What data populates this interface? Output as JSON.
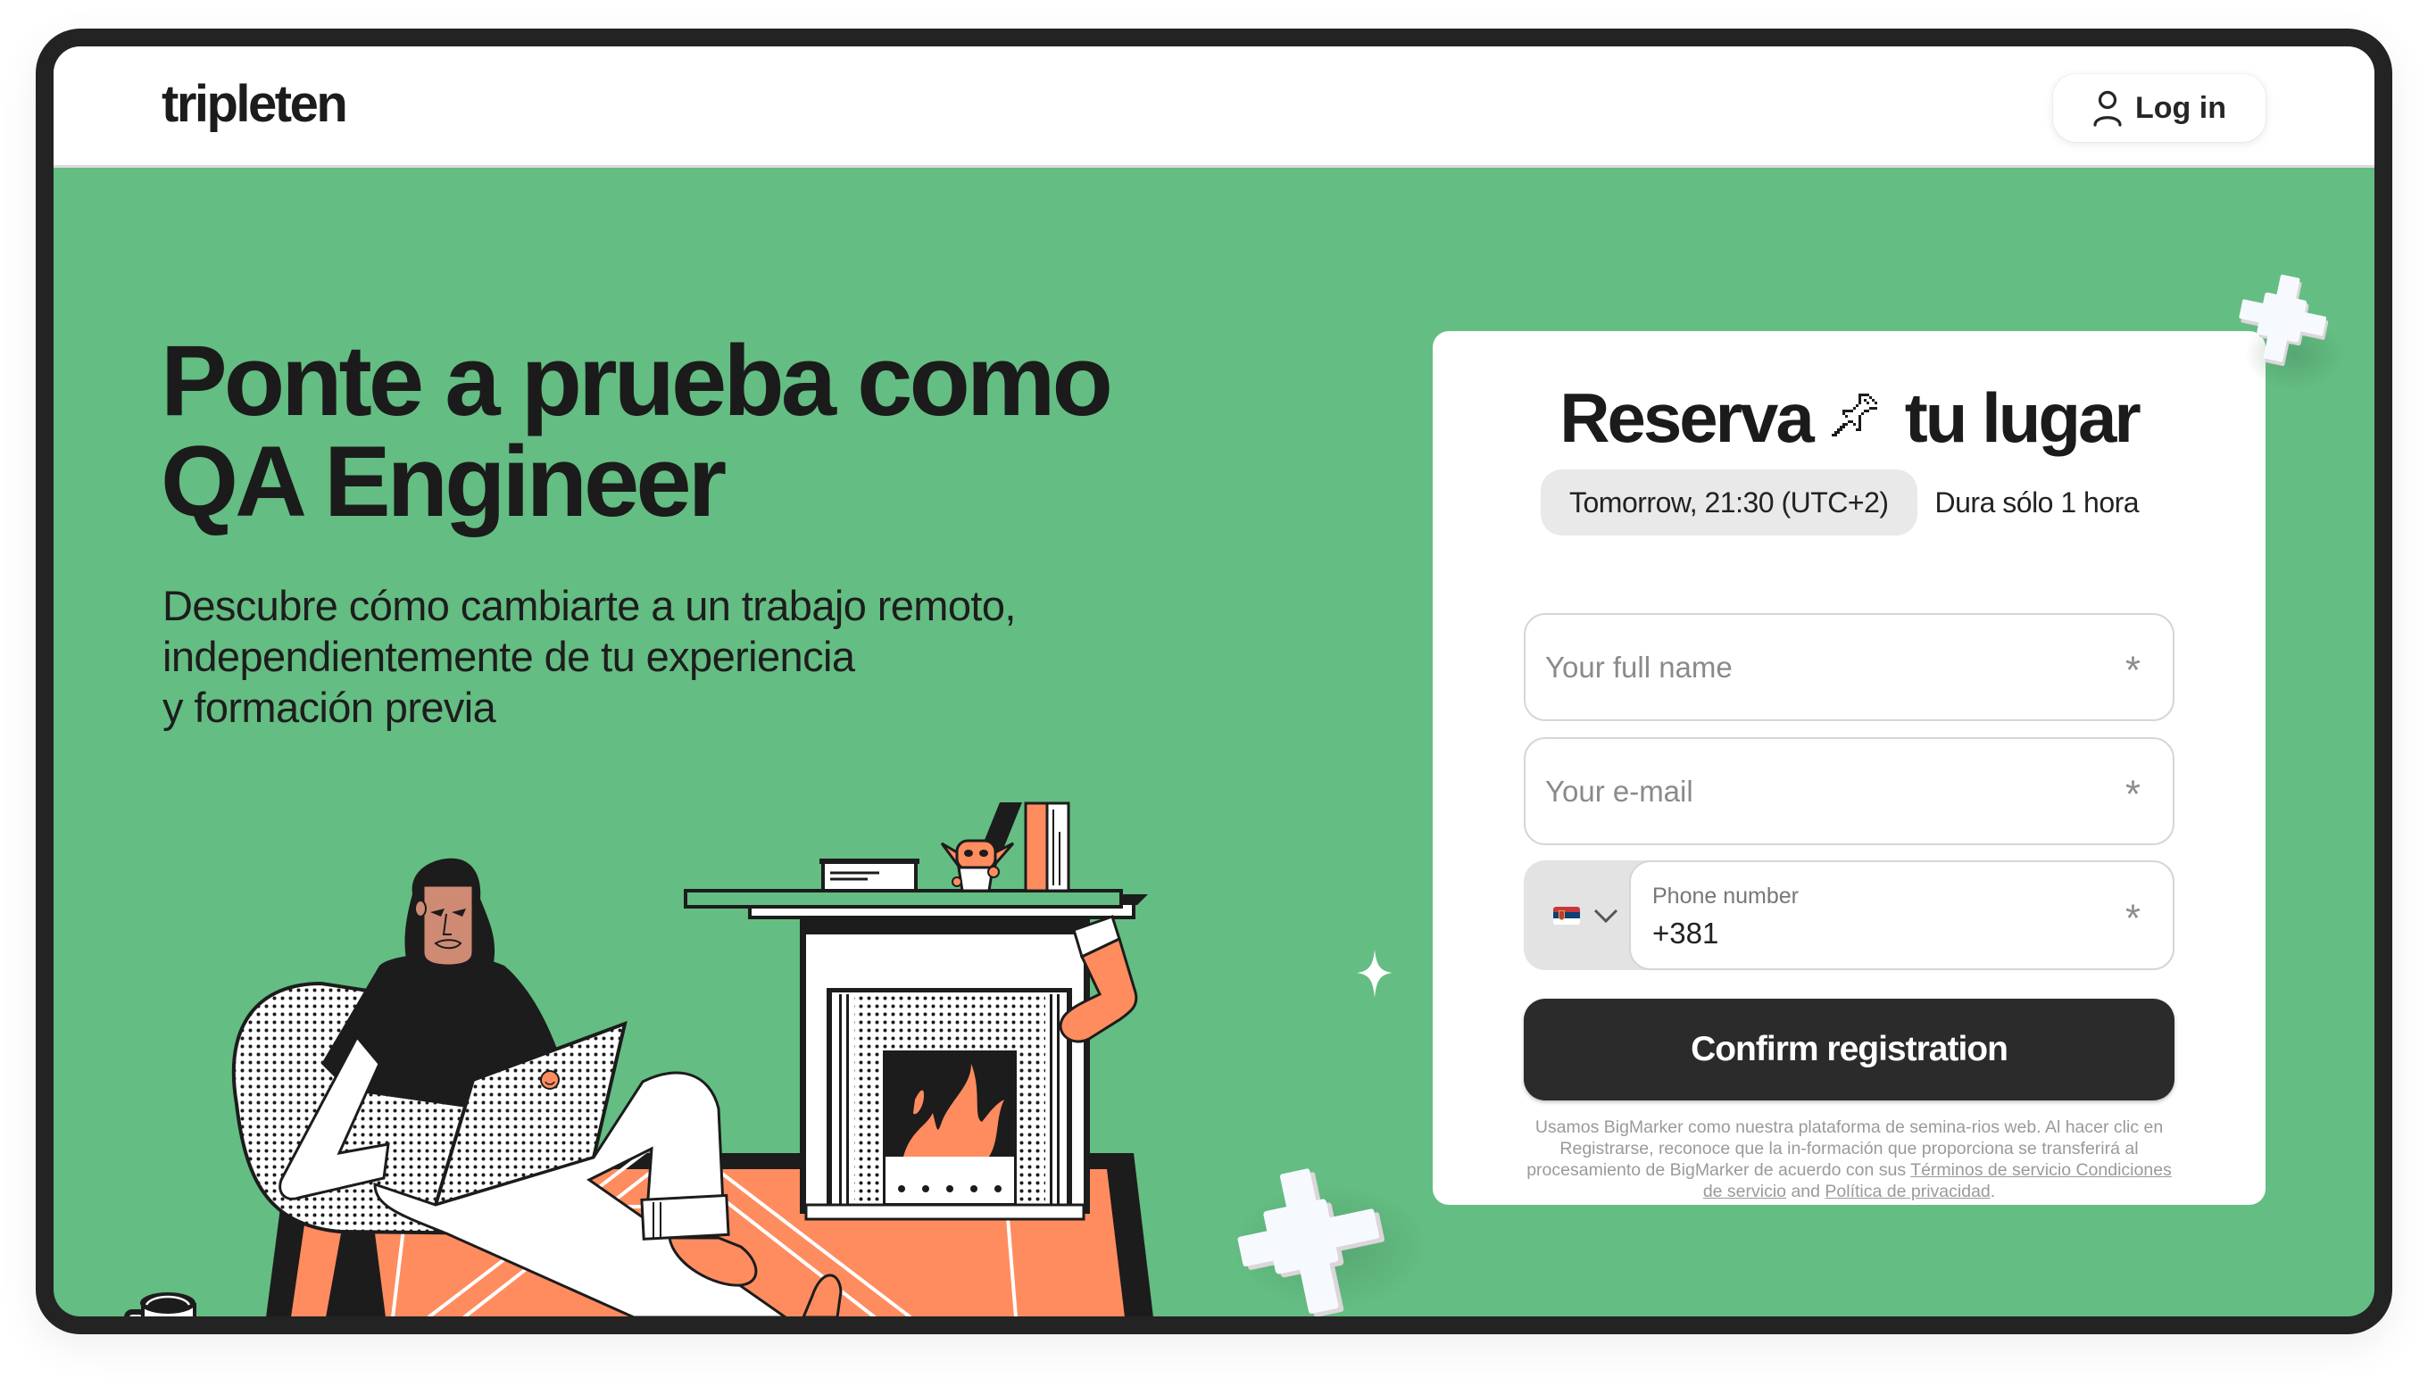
{
  "header": {
    "logo": "tripleten",
    "login_label": "Log in",
    "login_icon": "user-icon"
  },
  "hero": {
    "title_line1": "Ponte a prueba como",
    "title_line2": "QA Engineer",
    "subtitle_lines": [
      "Descubre cómo cambiarte a un trabajo remoto,",
      "independientemente de tu experiencia",
      "y formación previa"
    ]
  },
  "registration": {
    "title_before": "Reserva",
    "title_icon": "pushpin-icon",
    "title_after": "tu lugar",
    "date": "Tomorrow, 21:30 (UTC+2)",
    "duration": "Dura sólo 1 hora",
    "fields": {
      "name": {
        "placeholder": "Your full name",
        "value": "",
        "required_mark": "*"
      },
      "email": {
        "placeholder": "Your e-mail",
        "value": "",
        "required_mark": "*"
      },
      "phone": {
        "label": "Phone number",
        "value": "+381",
        "required_mark": "*",
        "country": "Serbia",
        "country_flag_icon": "serbia-flag-icon"
      }
    },
    "submit_label": "Confirm registration",
    "disclaimer": {
      "text_1": "Usamos BigMarker como nuestra plataforma de semina-rios web. Al hacer clic en Registrarse, reconoce que la in-formación que proporciona se transferirá al procesamiento de BigMarker de acuerdo con sus ",
      "terms_link": "Términos de servicio Condiciones de servicio",
      "text_2": " and ",
      "privacy_link": "Política de privacidad",
      "text_3": "."
    }
  },
  "colors": {
    "background_green": "#64bd82",
    "frame": "#232323",
    "accent_orange": "#ff8c5f",
    "button_dark": "#2b2b2b",
    "pill_gray": "#e9e9e9"
  }
}
